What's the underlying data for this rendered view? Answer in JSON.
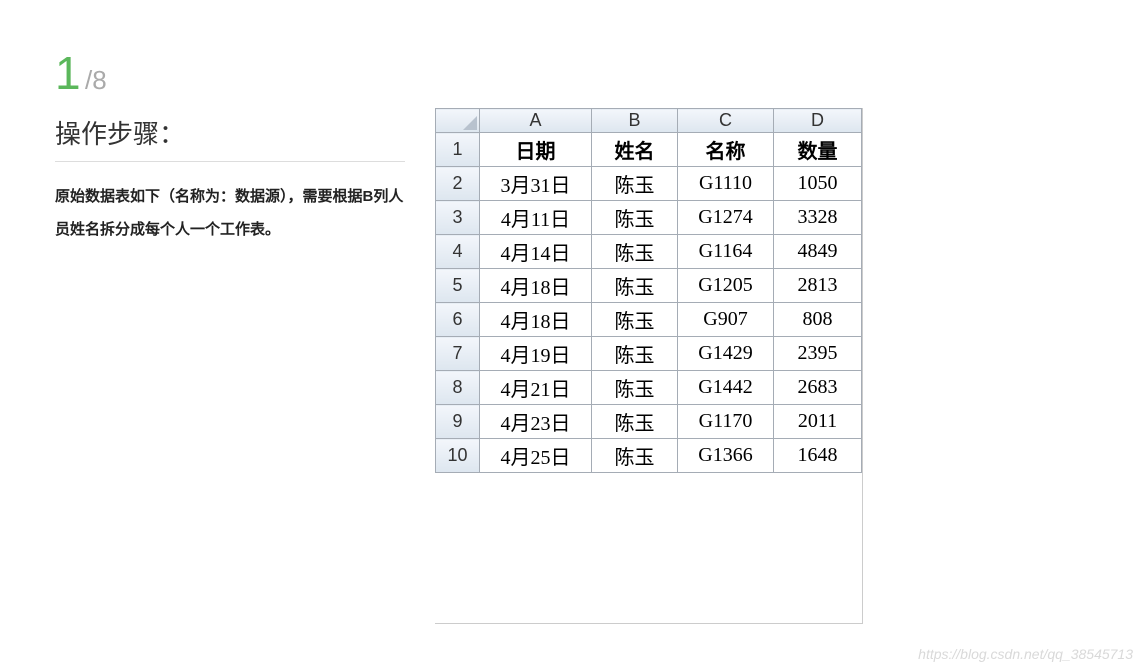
{
  "step": {
    "current": "1",
    "sep": "/",
    "total": "8"
  },
  "heading": "操作步骤：",
  "desc": "原始数据表如下（名称为：数据源），需要根据B列人员姓名拆分成每个人一个工作表。",
  "sheet": {
    "col_headers": [
      "A",
      "B",
      "C",
      "D"
    ],
    "row_headers": [
      "1",
      "2",
      "3",
      "4",
      "5",
      "6",
      "7",
      "8",
      "9",
      "10"
    ],
    "rows": [
      {
        "a": "日期",
        "b": "姓名",
        "c": "名称",
        "d": "数量"
      },
      {
        "a": "3月31日",
        "b": "陈玉",
        "c": "G1110",
        "d": "1050"
      },
      {
        "a": "4月11日",
        "b": "陈玉",
        "c": "G1274",
        "d": "3328"
      },
      {
        "a": "4月14日",
        "b": "陈玉",
        "c": "G1164",
        "d": "4849"
      },
      {
        "a": "4月18日",
        "b": "陈玉",
        "c": "G1205",
        "d": "2813"
      },
      {
        "a": "4月18日",
        "b": "陈玉",
        "c": "G907",
        "d": "808"
      },
      {
        "a": "4月19日",
        "b": "陈玉",
        "c": "G1429",
        "d": "2395"
      },
      {
        "a": "4月21日",
        "b": "陈玉",
        "c": "G1442",
        "d": "2683"
      },
      {
        "a": "4月23日",
        "b": "陈玉",
        "c": "G1170",
        "d": "2011"
      },
      {
        "a": "4月25日",
        "b": "陈玉",
        "c": "G1366",
        "d": "1648"
      }
    ]
  },
  "watermark": "https://blog.csdn.net/qq_38545713"
}
